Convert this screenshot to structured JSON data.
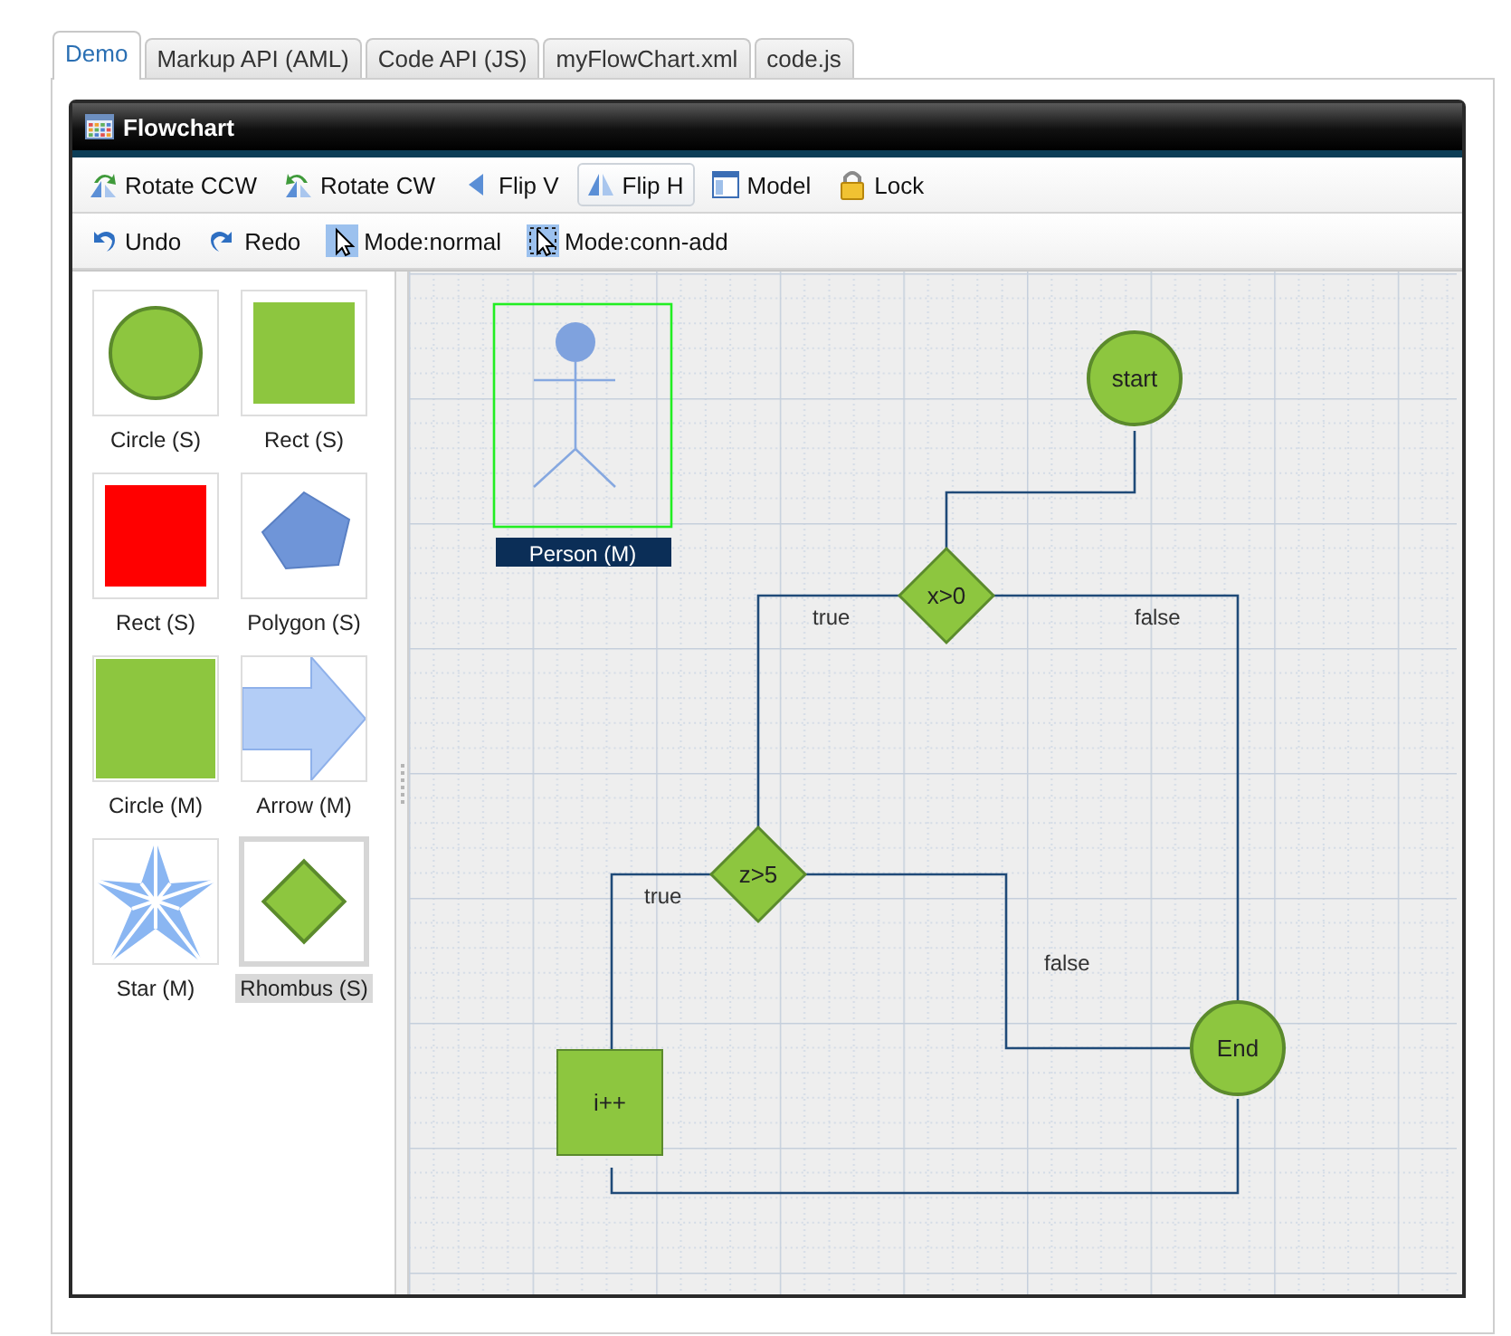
{
  "tabs": [
    {
      "label": "Demo",
      "selected": true
    },
    {
      "label": "Markup API (AML)",
      "selected": false
    },
    {
      "label": "Code API (JS)",
      "selected": false
    },
    {
      "label": "myFlowChart.xml",
      "selected": false
    },
    {
      "label": "code.js",
      "selected": false
    }
  ],
  "window": {
    "title": "Flowchart"
  },
  "toolbar_1": [
    {
      "kind": "rotate-ccw",
      "label": "Rotate CCW",
      "pressed": false
    },
    {
      "kind": "rotate-cw",
      "label": "Rotate CW",
      "pressed": false
    },
    {
      "kind": "flip-v",
      "label": "Flip V",
      "pressed": false
    },
    {
      "kind": "flip-h",
      "label": "Flip H",
      "pressed": true
    },
    {
      "kind": "model",
      "label": "Model",
      "pressed": false
    },
    {
      "kind": "lock",
      "label": "Lock",
      "pressed": false
    }
  ],
  "toolbar_2": [
    {
      "kind": "undo",
      "label": "Undo",
      "pressed": false
    },
    {
      "kind": "redo",
      "label": "Redo",
      "pressed": false
    },
    {
      "kind": "mode-normal",
      "label": "Mode:normal",
      "pressed": false
    },
    {
      "kind": "mode-conn",
      "label": "Mode:conn-add",
      "pressed": false
    }
  ],
  "palette": [
    {
      "kind": "circle",
      "label": "Circle (S)",
      "color": "#8dc63f",
      "selected": false
    },
    {
      "kind": "square",
      "label": "Rect (S)",
      "color": "#8dc63f",
      "selected": false
    },
    {
      "kind": "square",
      "label": "Rect (S)",
      "color": "#ff0000",
      "selected": false
    },
    {
      "kind": "pentagon",
      "label": "Polygon (S)",
      "color": "#6f95d8",
      "selected": false
    },
    {
      "kind": "square",
      "label": "Circle (M)",
      "color": "#8dc63f",
      "selected": false
    },
    {
      "kind": "arrow",
      "label": "Arrow (M)",
      "color": "#b3cdf6",
      "selected": false
    },
    {
      "kind": "star",
      "label": "Star (M)",
      "color": "#8ab6f2",
      "selected": false
    },
    {
      "kind": "rhombus",
      "label": "Rhombus (S)",
      "color": "#8dc63f",
      "selected": true
    }
  ],
  "canvas": {
    "nodes": [
      {
        "kind": "actor",
        "label": "Person (M)",
        "selected": true
      },
      {
        "kind": "circle",
        "label": "start",
        "selected": false
      },
      {
        "kind": "diamond",
        "label": "x>0",
        "selected": false
      },
      {
        "kind": "diamond",
        "label": "z>5",
        "selected": false
      },
      {
        "kind": "circle",
        "label": "End",
        "selected": false
      },
      {
        "kind": "rect",
        "label": "i++",
        "selected": false
      }
    ],
    "connector_labels": [
      "true",
      "false",
      "true",
      "false"
    ]
  }
}
